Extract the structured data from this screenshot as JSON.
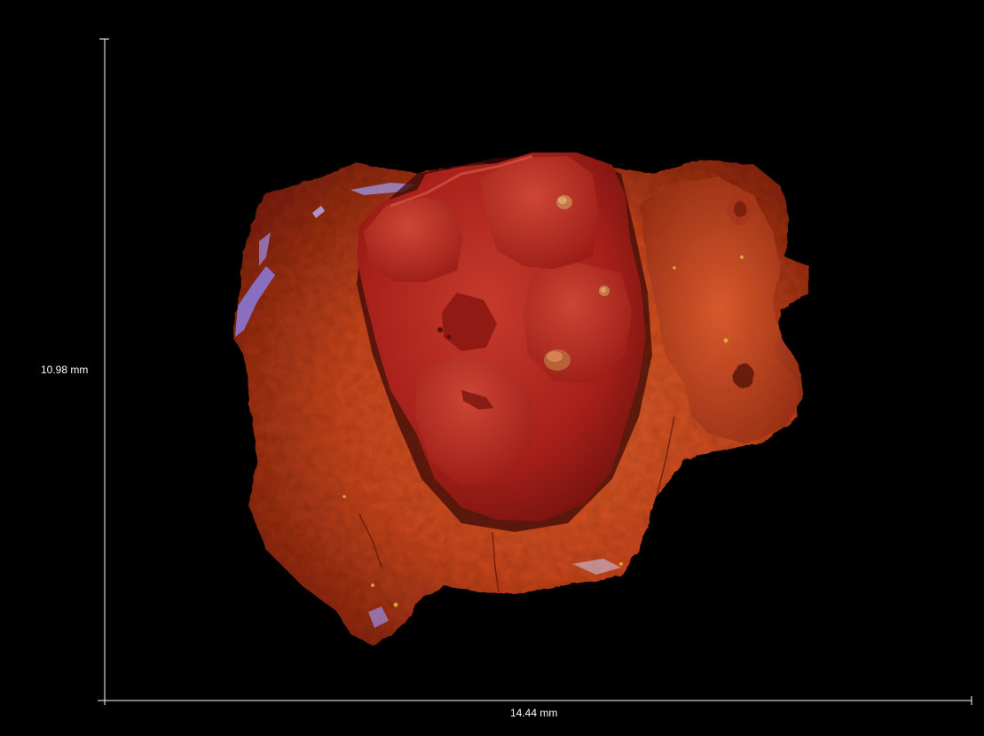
{
  "scale_bar": {
    "height_label": "10.98 mm",
    "width_label": "14.44 mm",
    "line_color": "#ffffff"
  },
  "specimen": {
    "matrix_color": "#c9461c",
    "tooth_color": "#a8201a",
    "highlight_color": "#e8743f",
    "shadow_color": "#5a0d08",
    "mineral_color": "#8a7de0"
  },
  "background_color": "#000000"
}
